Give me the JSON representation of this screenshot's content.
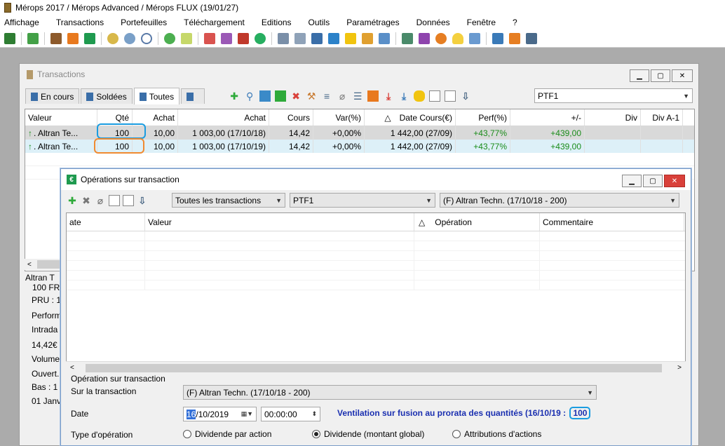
{
  "app": {
    "title": "Mérops 2017 / Mérops Advanced / Mérops FLUX (19/01/27)"
  },
  "menu": [
    "Affichage",
    "Transactions",
    "Portefeuilles",
    "Téléchargement",
    "Editions",
    "Outils",
    "Paramétrages",
    "Données",
    "Fenêtre",
    "?"
  ],
  "toolbar_icons": [
    "portfolio-icon",
    "download-icon",
    "wallet-icon",
    "euro-orange-icon",
    "euro-green-icon",
    "coins-icon",
    "currency-icon",
    "clock-icon",
    "globe-icon",
    "folder-icon",
    "chart-red-icon",
    "chart-purple-icon",
    "book-icon",
    "tree-icon",
    "printer-icon",
    "printer2-icon",
    "document-icon",
    "calculator-icon",
    "folder2-icon",
    "tools-icon",
    "network-icon",
    "window-icon",
    "bookmark-icon",
    "user-icon",
    "bell-icon",
    "mail-icon",
    "stack-icon",
    "rss-icon",
    "list-icon"
  ],
  "transactions": {
    "title": "Transactions",
    "tabs": [
      {
        "label": "En cours"
      },
      {
        "label": "Soldées"
      },
      {
        "label": "Toutes"
      },
      {
        "label": ""
      }
    ],
    "portfolio_combo": "PTF1",
    "columns": [
      "Valeur",
      "Qté",
      "Achat",
      "Achat",
      "Cours",
      "Var(%)",
      "Date Cours(€)",
      "Perf(%)",
      "+/-",
      "Div",
      "Div A-1"
    ],
    "rows": [
      {
        "valeur": ". Altran Te...",
        "qte": "100",
        "achat": "10,00",
        "achat_total": "1 003,00 (17/10/18)",
        "cours": "14,42",
        "var": "+0,00%",
        "date_cours": "1 442,00 (27/09)",
        "perf": "+43,77%",
        "plusmoins": "+439,00"
      },
      {
        "valeur": ". Altran Te...",
        "qte": "100",
        "achat": "10,00",
        "achat_total": "1 003,00 (17/10/19)",
        "cours": "14,42",
        "var": "+0,00%",
        "date_cours": "1 442,00 (27/09)",
        "perf": "+43,77%",
        "plusmoins": "+439,00"
      }
    ],
    "detail": {
      "line1": "Altran T",
      "line2": "100 FR",
      "line3": "PRU : 1",
      "line4": "Perform",
      "line5": "Intrada",
      "line6": "14,42€",
      "line7": "Volume",
      "line8": "Ouvert.",
      "line9": "Bas : 1",
      "line10": "01 Janv"
    }
  },
  "operations": {
    "title": "Opérations sur transaction",
    "filter_combo": "Toutes les transactions",
    "portfolio_combo": "PTF1",
    "transaction_combo": "(F) Altran Techn. (17/10/18 - 200)",
    "columns": [
      "ate",
      "Valeur",
      "Opération",
      "Commentaire"
    ],
    "form": {
      "section_label": "Opération sur transaction",
      "transaction_label": "Sur la transaction",
      "transaction_value": "(F) Altran Techn. (17/10/18 - 200)",
      "date_label": "Date",
      "date_day": "16",
      "date_rest": "/10/2019",
      "time_value": "00:00:00",
      "note": "Ventilation sur fusion au prorata des  quantités (16/10/19 :",
      "note_qty": "100",
      "type_label": "Type d'opération",
      "radio1": "Dividende par action",
      "radio2": "Dividende (montant global)",
      "radio3": "Attributions d'actions"
    }
  },
  "colors": {
    "green": "#1a8c1a",
    "highlight_blue": "#1a9ce0",
    "highlight_orange": "#f08a30",
    "note_blue": "#1a2fb0"
  }
}
